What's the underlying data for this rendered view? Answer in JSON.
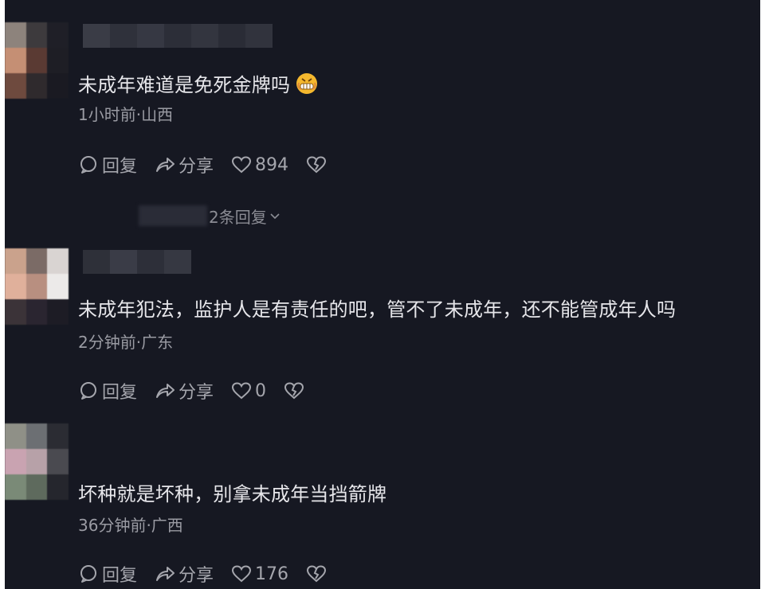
{
  "comments": [
    {
      "text": "未成年难道是免死金牌吗",
      "emoji": "grimacing-emoji",
      "meta": "1小时前·山西",
      "reply_label": "回复",
      "share_label": "分享",
      "like_count": "894",
      "avatar_colors": [
        "#8d837c",
        "#3d3a3d",
        "#1f1f27",
        "#c58f74",
        "#5a3a33",
        "#1e1e25",
        "#6e4a3e",
        "#2f2a2d",
        "#1a1a22"
      ],
      "name_colors": [
        "#3a3c46",
        "#2f313b",
        "#363843",
        "#2c2e38",
        "#33353f",
        "#2a2c36",
        "#31333d"
      ]
    },
    {
      "text": "未成年犯法，监护人是有责任的吧，管不了未成年，还不能管成年人吗",
      "meta": "2分钟前·广东",
      "reply_label": "回复",
      "share_label": "分享",
      "like_count": "0",
      "avatar_colors": [
        "#caa28c",
        "#7b6b66",
        "#d9d4d2",
        "#e0b09b",
        "#b88f80",
        "#eceae9",
        "#3b3338",
        "#2a2530",
        "#1d1c25"
      ],
      "name_colors": [
        "#2e3039",
        "#3a3c47",
        "#2d2f39",
        "#363842"
      ]
    },
    {
      "text": "坏种就是坏种，别拿未成年当挡箭牌",
      "meta": "36分钟前·广西",
      "reply_label": "回复",
      "share_label": "分享",
      "like_count": "176",
      "avatar_colors": [
        "#8f9087",
        "#6c6f73",
        "#2b2c33",
        "#c9a3b1",
        "#b7a1a8",
        "#4a4a50",
        "#7a8a77",
        "#5e6a5d",
        "#25262d"
      ],
      "name_colors": []
    }
  ],
  "replies_toggle": "2条回复",
  "colors": {
    "background": "#161822",
    "text": "#e6e6ea",
    "meta": "#9a9ba3",
    "action": "#a5a6ad"
  }
}
